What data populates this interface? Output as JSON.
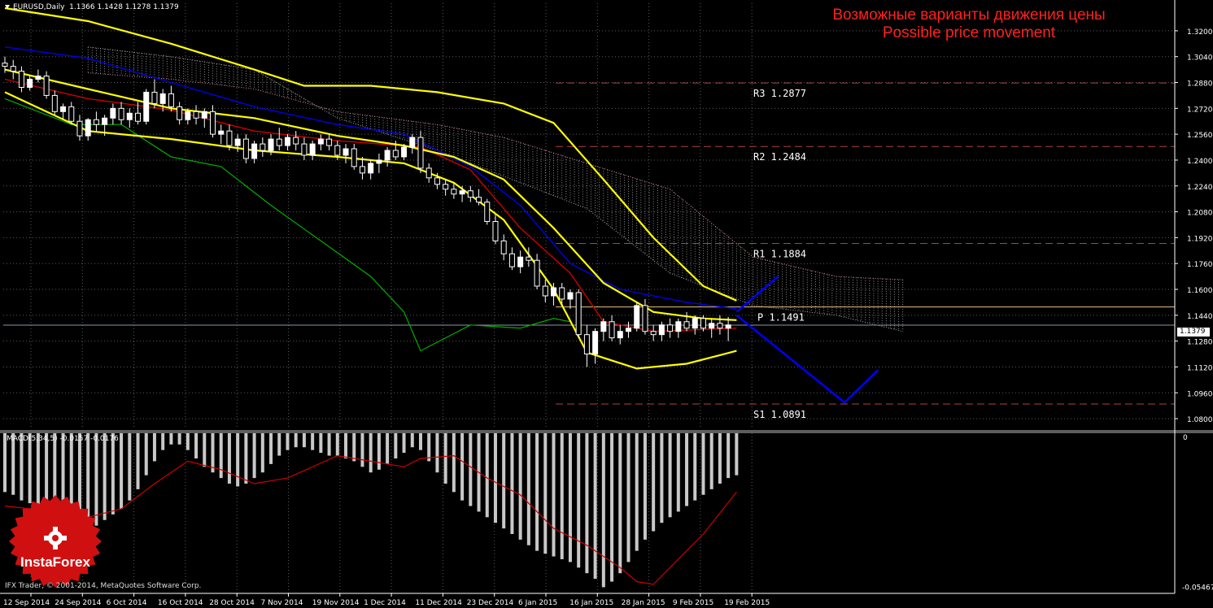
{
  "header": {
    "symbol": "EURUSD,Daily",
    "ohlc": "1.1366 1.1428 1.1278 1.1379"
  },
  "title": {
    "ru": "Возможные варианты движения цены",
    "en": "Possible price movement"
  },
  "macd_header": "MACD(5,34,5) -0.0157 -0.0176",
  "copyright": "IFX Trader, © 2001-2014, MetaQuotes Software Corp.",
  "logo": {
    "label": "InstaForex"
  },
  "colors": {
    "background": "#000000",
    "grid": "#5a5a5a",
    "bull_candle": "#ffffff",
    "bear_candle": "#000000",
    "bollinger": "#ffff00",
    "ma_red": "#cc0000",
    "ma_blue": "#0000ee",
    "chikou": "#00b000",
    "forecast": "#0000ff",
    "pivot_dashed": "#b04040",
    "pivot_solid": "#e8c080",
    "title": "#ff2020",
    "histogram": "#c8c8c8",
    "signal": "#cc0000"
  },
  "chart_data": {
    "type": "candlestick",
    "symbol": "EURUSD",
    "timeframe": "Daily",
    "current_price": "1.1379",
    "ylim": [
      1.074,
      1.33
    ],
    "yticks": [
      "1.3200",
      "1.3040",
      "1.2880",
      "1.2720",
      "1.2560",
      "1.2400",
      "1.2240",
      "1.2080",
      "1.1920",
      "1.1760",
      "1.1600",
      "1.1440",
      "1.1280",
      "1.1120",
      "1.0960",
      "1.0800"
    ],
    "xticks": [
      "12 Sep 2014",
      "24 Sep 2014",
      "6 Oct 2014",
      "16 Oct 2014",
      "28 Oct 2014",
      "7 Nov 2014",
      "19 Nov 2014",
      "1 Dec 2014",
      "11 Dec 2014",
      "23 Dec 2014",
      "6 Jan 2015",
      "16 Jan 2015",
      "28 Jan 2015",
      "9 Feb 2015",
      "19 Feb 2015"
    ],
    "candles": [
      [
        1.3,
        1.304,
        1.294,
        1.298
      ],
      [
        1.298,
        1.302,
        1.29,
        1.295
      ],
      [
        1.295,
        1.298,
        1.282,
        1.285
      ],
      [
        1.285,
        1.292,
        1.283,
        1.29
      ],
      [
        1.29,
        1.296,
        1.288,
        1.292
      ],
      [
        1.292,
        1.295,
        1.278,
        1.28
      ],
      [
        1.28,
        1.283,
        1.268,
        1.27
      ],
      [
        1.27,
        1.275,
        1.265,
        1.273
      ],
      [
        1.273,
        1.276,
        1.262,
        1.264
      ],
      [
        1.264,
        1.268,
        1.252,
        1.255
      ],
      [
        1.255,
        1.266,
        1.252,
        1.265
      ],
      [
        1.265,
        1.27,
        1.258,
        1.262
      ],
      [
        1.262,
        1.268,
        1.255,
        1.266
      ],
      [
        1.266,
        1.275,
        1.262,
        1.272
      ],
      [
        1.272,
        1.276,
        1.262,
        1.265
      ],
      [
        1.265,
        1.272,
        1.26,
        1.269
      ],
      [
        1.269,
        1.276,
        1.262,
        1.264
      ],
      [
        1.264,
        1.284,
        1.262,
        1.282
      ],
      [
        1.282,
        1.29,
        1.272,
        1.275
      ],
      [
        1.275,
        1.284,
        1.27,
        1.281
      ],
      [
        1.281,
        1.286,
        1.27,
        1.273
      ],
      [
        1.273,
        1.276,
        1.262,
        1.265
      ],
      [
        1.265,
        1.272,
        1.262,
        1.27
      ],
      [
        1.27,
        1.274,
        1.262,
        1.266
      ],
      [
        1.266,
        1.272,
        1.26,
        1.27
      ],
      [
        1.27,
        1.274,
        1.254,
        1.256
      ],
      [
        1.256,
        1.262,
        1.25,
        1.258
      ],
      [
        1.258,
        1.262,
        1.246,
        1.249
      ],
      [
        1.249,
        1.256,
        1.245,
        1.253
      ],
      [
        1.253,
        1.256,
        1.238,
        1.241
      ],
      [
        1.241,
        1.252,
        1.238,
        1.25
      ],
      [
        1.25,
        1.254,
        1.242,
        1.246
      ],
      [
        1.246,
        1.256,
        1.243,
        1.253
      ],
      [
        1.253,
        1.26,
        1.246,
        1.249
      ],
      [
        1.249,
        1.256,
        1.246,
        1.254
      ],
      [
        1.254,
        1.258,
        1.246,
        1.25
      ],
      [
        1.25,
        1.254,
        1.24,
        1.243
      ],
      [
        1.243,
        1.252,
        1.24,
        1.25
      ],
      [
        1.25,
        1.256,
        1.246,
        1.253
      ],
      [
        1.253,
        1.256,
        1.246,
        1.249
      ],
      [
        1.249,
        1.252,
        1.24,
        1.243
      ],
      [
        1.243,
        1.25,
        1.238,
        1.247
      ],
      [
        1.247,
        1.25,
        1.234,
        1.236
      ],
      [
        1.236,
        1.242,
        1.228,
        1.232
      ],
      [
        1.232,
        1.24,
        1.228,
        1.238
      ],
      [
        1.238,
        1.244,
        1.232,
        1.24
      ],
      [
        1.24,
        1.248,
        1.236,
        1.246
      ],
      [
        1.246,
        1.252,
        1.24,
        1.242
      ],
      [
        1.242,
        1.25,
        1.24,
        1.248
      ],
      [
        1.248,
        1.256,
        1.244,
        1.254
      ],
      [
        1.254,
        1.258,
        1.232,
        1.235
      ],
      [
        1.235,
        1.238,
        1.226,
        1.229
      ],
      [
        1.229,
        1.232,
        1.222,
        1.225
      ],
      [
        1.225,
        1.228,
        1.218,
        1.222
      ],
      [
        1.222,
        1.226,
        1.216,
        1.219
      ],
      [
        1.219,
        1.224,
        1.214,
        1.221
      ],
      [
        1.221,
        1.224,
        1.214,
        1.217
      ],
      [
        1.217,
        1.222,
        1.212,
        1.214
      ],
      [
        1.214,
        1.216,
        1.2,
        1.202
      ],
      [
        1.202,
        1.206,
        1.188,
        1.19
      ],
      [
        1.19,
        1.194,
        1.178,
        1.182
      ],
      [
        1.182,
        1.186,
        1.172,
        1.174
      ],
      [
        1.174,
        1.184,
        1.17,
        1.18
      ],
      [
        1.18,
        1.186,
        1.174,
        1.178
      ],
      [
        1.178,
        1.182,
        1.16,
        1.162
      ],
      [
        1.162,
        1.166,
        1.152,
        1.156
      ],
      [
        1.156,
        1.164,
        1.15,
        1.161
      ],
      [
        1.161,
        1.164,
        1.15,
        1.154
      ],
      [
        1.154,
        1.16,
        1.148,
        1.158
      ],
      [
        1.158,
        1.16,
        1.13,
        1.132
      ],
      [
        1.132,
        1.138,
        1.112,
        1.12
      ],
      [
        1.12,
        1.136,
        1.114,
        1.134
      ],
      [
        1.134,
        1.142,
        1.128,
        1.14
      ],
      [
        1.14,
        1.144,
        1.128,
        1.13
      ],
      [
        1.13,
        1.138,
        1.126,
        1.134
      ],
      [
        1.134,
        1.14,
        1.13,
        1.136
      ],
      [
        1.136,
        1.152,
        1.134,
        1.15
      ],
      [
        1.15,
        1.154,
        1.132,
        1.134
      ],
      [
        1.134,
        1.138,
        1.128,
        1.132
      ],
      [
        1.132,
        1.14,
        1.128,
        1.138
      ],
      [
        1.138,
        1.142,
        1.13,
        1.134
      ],
      [
        1.134,
        1.142,
        1.13,
        1.14
      ],
      [
        1.14,
        1.146,
        1.134,
        1.136
      ],
      [
        1.136,
        1.144,
        1.132,
        1.142
      ],
      [
        1.142,
        1.144,
        1.134,
        1.136
      ],
      [
        1.136,
        1.142,
        1.13,
        1.139
      ],
      [
        1.139,
        1.144,
        1.132,
        1.136
      ],
      [
        1.136,
        1.143,
        1.128,
        1.138
      ]
    ],
    "bollinger": {
      "upper": [
        [
          0,
          1.334
        ],
        [
          10,
          1.326
        ],
        [
          20,
          1.312
        ],
        [
          30,
          1.296
        ],
        [
          36,
          1.286
        ],
        [
          44,
          1.286
        ],
        [
          52,
          1.282
        ],
        [
          60,
          1.275
        ],
        [
          66,
          1.263
        ],
        [
          72,
          1.228
        ],
        [
          78,
          1.192
        ],
        [
          84,
          1.162
        ],
        [
          88,
          1.153
        ]
      ],
      "middle": [
        [
          0,
          1.296
        ],
        [
          10,
          1.284
        ],
        [
          20,
          1.272
        ],
        [
          30,
          1.266
        ],
        [
          40,
          1.255
        ],
        [
          48,
          1.249
        ],
        [
          54,
          1.242
        ],
        [
          60,
          1.228
        ],
        [
          66,
          1.198
        ],
        [
          72,
          1.164
        ],
        [
          78,
          1.146
        ],
        [
          84,
          1.142
        ],
        [
          88,
          1.141
        ]
      ],
      "lower": [
        [
          0,
          1.282
        ],
        [
          10,
          1.258
        ],
        [
          20,
          1.253
        ],
        [
          30,
          1.246
        ],
        [
          40,
          1.242
        ],
        [
          48,
          1.238
        ],
        [
          54,
          1.226
        ],
        [
          60,
          1.203
        ],
        [
          66,
          1.16
        ],
        [
          70,
          1.121
        ],
        [
          76,
          1.111
        ],
        [
          82,
          1.114
        ],
        [
          88,
          1.122
        ]
      ]
    },
    "ma_red": [
      [
        0,
        1.29
      ],
      [
        10,
        1.278
      ],
      [
        20,
        1.271
      ],
      [
        30,
        1.258
      ],
      [
        40,
        1.252
      ],
      [
        50,
        1.248
      ],
      [
        56,
        1.234
      ],
      [
        62,
        1.198
      ],
      [
        68,
        1.17
      ],
      [
        72,
        1.14
      ],
      [
        78,
        1.134
      ],
      [
        88,
        1.136
      ]
    ],
    "ma_blue": [
      [
        0,
        1.31
      ],
      [
        10,
        1.303
      ],
      [
        20,
        1.288
      ],
      [
        30,
        1.273
      ],
      [
        40,
        1.262
      ],
      [
        48,
        1.256
      ],
      [
        56,
        1.236
      ],
      [
        62,
        1.212
      ],
      [
        68,
        1.176
      ],
      [
        74,
        1.16
      ],
      [
        82,
        1.152
      ],
      [
        88,
        1.148
      ]
    ],
    "chikou": [
      [
        0,
        1.278
      ],
      [
        8,
        1.262
      ],
      [
        14,
        1.262
      ],
      [
        20,
        1.242
      ],
      [
        26,
        1.236
      ],
      [
        32,
        1.212
      ],
      [
        38,
        1.19
      ],
      [
        44,
        1.168
      ],
      [
        48,
        1.146
      ],
      [
        50,
        1.122
      ],
      [
        56,
        1.138
      ],
      [
        62,
        1.136
      ],
      [
        66,
        1.142
      ],
      [
        68,
        1.14
      ]
    ],
    "cloud": {
      "span_a": [
        [
          10,
          1.294
        ],
        [
          20,
          1.29
        ],
        [
          30,
          1.284
        ],
        [
          40,
          1.27
        ],
        [
          52,
          1.262
        ],
        [
          60,
          1.254
        ],
        [
          70,
          1.238
        ],
        [
          80,
          1.222
        ],
        [
          90,
          1.18
        ],
        [
          100,
          1.168
        ],
        [
          108,
          1.166
        ]
      ],
      "span_b": [
        [
          10,
          1.31
        ],
        [
          20,
          1.304
        ],
        [
          30,
          1.296
        ],
        [
          40,
          1.266
        ],
        [
          52,
          1.246
        ],
        [
          60,
          1.23
        ],
        [
          70,
          1.21
        ],
        [
          80,
          1.17
        ],
        [
          90,
          1.15
        ],
        [
          100,
          1.144
        ],
        [
          108,
          1.134
        ]
      ]
    },
    "pivot_levels": [
      {
        "label": "R3 1.2877",
        "value": 1.2877,
        "style": "dashed"
      },
      {
        "label": "R2 1.2484",
        "value": 1.2484,
        "style": "dashed"
      },
      {
        "label": "R1 1.1884",
        "value": 1.1884,
        "style": "dashed"
      },
      {
        "label": "P 1.1491",
        "value": 1.1491,
        "style": "solid"
      },
      {
        "label": "S1 1.0891",
        "value": 1.0891,
        "style": "dashed"
      }
    ],
    "forecast": {
      "up_path": [
        [
          88,
          1.146
        ],
        [
          93,
          1.168
        ]
      ],
      "down_path": [
        [
          88,
          1.144
        ],
        [
          101,
          1.09
        ],
        [
          105,
          1.11
        ]
      ]
    },
    "macd": {
      "ylim": [
        -0.0572,
        0.0
      ],
      "yticks": [
        "0",
        "-0.05467"
      ],
      "histogram": [
        -0.021,
        -0.022,
        -0.024,
        -0.025,
        -0.027,
        -0.028,
        -0.029,
        -0.03,
        -0.032,
        -0.033,
        -0.034,
        -0.033,
        -0.031,
        -0.029,
        -0.027,
        -0.024,
        -0.02,
        -0.015,
        -0.01,
        -0.006,
        -0.004,
        -0.004,
        -0.006,
        -0.009,
        -0.012,
        -0.014,
        -0.016,
        -0.018,
        -0.019,
        -0.018,
        -0.016,
        -0.014,
        -0.011,
        -0.008,
        -0.006,
        -0.005,
        -0.005,
        -0.006,
        -0.007,
        -0.008,
        -0.008,
        -0.009,
        -0.01,
        -0.012,
        -0.014,
        -0.013,
        -0.011,
        -0.009,
        -0.007,
        -0.005,
        -0.006,
        -0.01,
        -0.014,
        -0.018,
        -0.021,
        -0.024,
        -0.026,
        -0.028,
        -0.03,
        -0.032,
        -0.034,
        -0.036,
        -0.038,
        -0.04,
        -0.042,
        -0.043,
        -0.044,
        -0.045,
        -0.046,
        -0.048,
        -0.05,
        -0.052,
        -0.055,
        -0.053,
        -0.05,
        -0.046,
        -0.042,
        -0.038,
        -0.035,
        -0.032,
        -0.03,
        -0.028,
        -0.026,
        -0.024,
        -0.022,
        -0.02,
        -0.018,
        -0.016,
        -0.015
      ],
      "signal": [
        [
          0,
          -0.026
        ],
        [
          6,
          -0.028
        ],
        [
          10,
          -0.03
        ],
        [
          14,
          -0.027
        ],
        [
          18,
          -0.018
        ],
        [
          22,
          -0.01
        ],
        [
          26,
          -0.013
        ],
        [
          30,
          -0.018
        ],
        [
          34,
          -0.016
        ],
        [
          40,
          -0.008
        ],
        [
          44,
          -0.01
        ],
        [
          48,
          -0.012
        ],
        [
          50,
          -0.009
        ],
        [
          54,
          -0.008
        ],
        [
          58,
          -0.016
        ],
        [
          62,
          -0.022
        ],
        [
          66,
          -0.034
        ],
        [
          70,
          -0.04
        ],
        [
          74,
          -0.048
        ],
        [
          76,
          -0.053
        ],
        [
          78,
          -0.054
        ],
        [
          80,
          -0.048
        ],
        [
          84,
          -0.036
        ],
        [
          88,
          -0.021
        ]
      ]
    }
  }
}
